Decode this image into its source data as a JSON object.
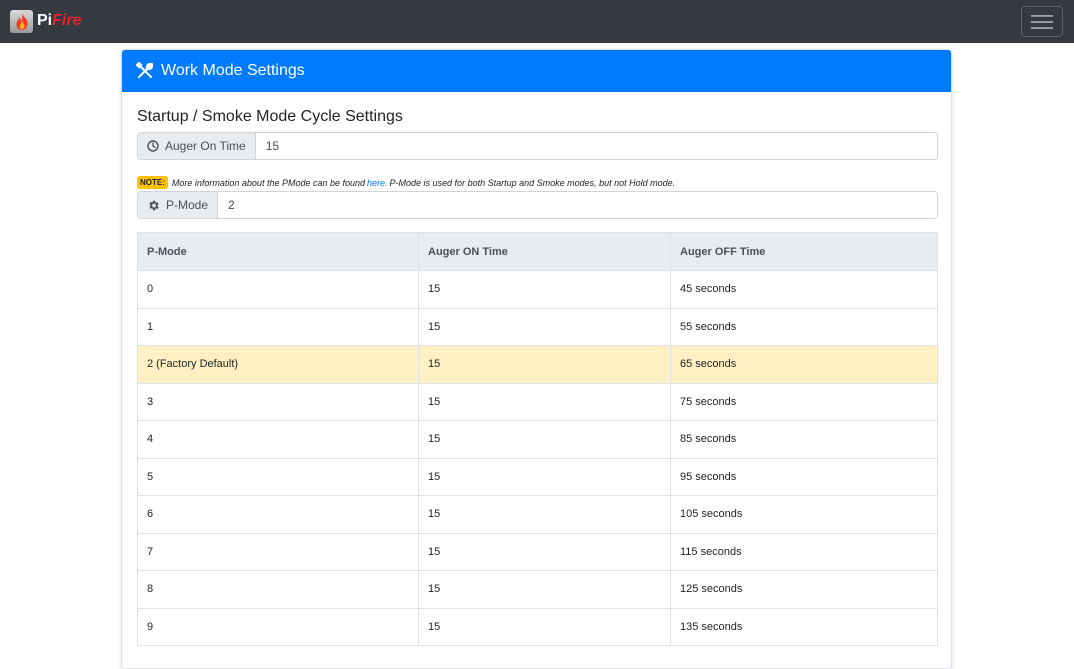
{
  "navbar": {
    "brand_pi": "Pi",
    "brand_fire": "Fire",
    "icons": {
      "logo": "flame-icon",
      "menu": "hamburger-icon"
    }
  },
  "card": {
    "header_title": "Work Mode Settings",
    "header_icon": "tools-icon",
    "section_title": "Startup / Smoke Mode Cycle Settings",
    "auger_on_time": {
      "label": "Auger On Time",
      "value": "15",
      "icon": "clock-icon"
    },
    "note": {
      "badge": "NOTE:",
      "text_before": "More information about the PMode can be found",
      "link": "here.",
      "text_after": "P-Mode is used for both Startup and Smoke modes, but not Hold mode."
    },
    "pmode": {
      "label": "P-Mode",
      "value": "2",
      "icon": "gear-icon"
    }
  },
  "table": {
    "headers": [
      "P-Mode",
      "Auger ON Time",
      "Auger OFF Time"
    ],
    "rows": [
      [
        "0",
        "15",
        "45 seconds"
      ],
      [
        "1",
        "15",
        "55 seconds"
      ],
      [
        "2 (Factory Default)",
        "15",
        "65 seconds"
      ],
      [
        "3",
        "15",
        "75 seconds"
      ],
      [
        "4",
        "15",
        "85 seconds"
      ],
      [
        "5",
        "15",
        "95 seconds"
      ],
      [
        "6",
        "15",
        "105 seconds"
      ],
      [
        "7",
        "15",
        "115 seconds"
      ],
      [
        "8",
        "15",
        "125 seconds"
      ],
      [
        "9",
        "15",
        "135 seconds"
      ]
    ]
  },
  "colors": {
    "navbar_bg": "#343a40",
    "header_bg": "#007bff",
    "brand_fire": "#e8232e",
    "note_badge": "#ffc107",
    "highlight_row": "#fff1c3"
  }
}
